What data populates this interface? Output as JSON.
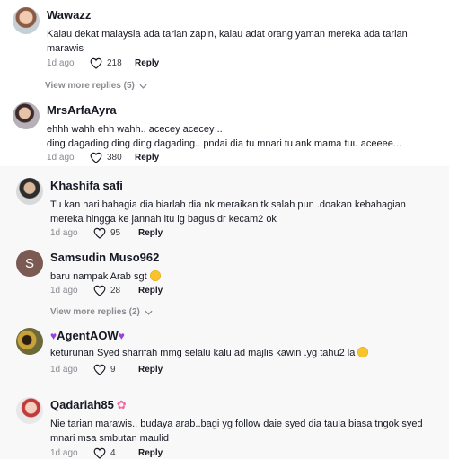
{
  "comments": [
    {
      "username": "Wawazz",
      "text": "Kalau dekat malaysia ada tarian zapin, kalau adat orang yaman mereka ada tarian marawis",
      "time": "1d ago",
      "likes": "218",
      "reply_label": "Reply",
      "view_more": "View more replies (5)"
    },
    {
      "username": "MrsArfaAyra",
      "text_line1": "ehhh wahh ehh wahh.. acecey acecey ..",
      "text_line2": "ding dagading ding ding dagading.. pndai dia tu mnari tu ank mama tuu aceeee...",
      "time": "1d ago",
      "likes": "380",
      "reply_label": "Reply"
    },
    {
      "username": "Khashifa safi",
      "text": "Tu kan hari bahagia dia biarlah dia nk meraikan tk salah pun .doakan kebahagian mereka hingga ke jannah itu lg bagus dr kecam2 ok",
      "time": "1d ago",
      "likes": "95",
      "reply_label": "Reply"
    },
    {
      "username": "Samsudin Muso962",
      "avatar_letter": "S",
      "text": "baru nampak Arab sgt",
      "time": "1d ago",
      "likes": "28",
      "reply_label": "Reply",
      "view_more": "View more replies (2)"
    },
    {
      "username": "AgentAOW",
      "text": "keturunan Syed sharifah mmg selalu kalu ad majlis kawin .yg tahu2 la",
      "time": "1d ago",
      "likes": "9",
      "reply_label": "Reply"
    },
    {
      "username": "Qadariah85",
      "text": "Nie tarian marawis.. budaya arab..bagi yg follow daie syed dia taula biasa tngok syed mnari msa smbutan maulid",
      "time": "1d ago",
      "likes": "4",
      "reply_label": "Reply"
    }
  ],
  "icons": {
    "like": "heart-outline-icon",
    "expand": "chevron-down-icon"
  }
}
